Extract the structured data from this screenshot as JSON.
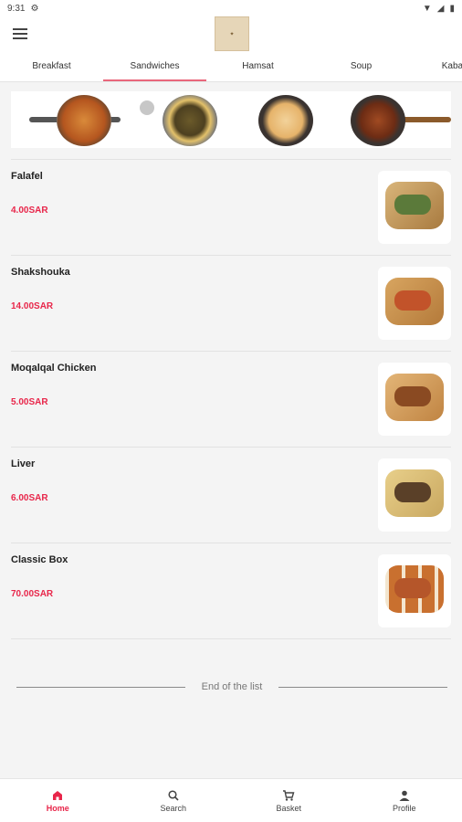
{
  "status": {
    "time": "9:31",
    "gear_icon": "gear-icon",
    "wifi_icon": "wifi-icon",
    "battery_icon": "battery-icon"
  },
  "header": {
    "menu_icon": "menu-icon",
    "logo_text": "logo"
  },
  "tabs": [
    {
      "label": "Breakfast"
    },
    {
      "label": "Sandwiches"
    },
    {
      "label": "Hamsat"
    },
    {
      "label": "Soup"
    },
    {
      "label": "Kabab & M"
    }
  ],
  "items": [
    {
      "name": "Falafel",
      "price": "4.00SAR"
    },
    {
      "name": "Shakshouka",
      "price": "14.00SAR"
    },
    {
      "name": "Moqalqal Chicken",
      "price": "5.00SAR"
    },
    {
      "name": "Liver",
      "price": "6.00SAR"
    },
    {
      "name": "Classic Box",
      "price": "70.00SAR"
    }
  ],
  "end_text": "End of the list",
  "nav": [
    {
      "label": "Home",
      "icon": "home-icon"
    },
    {
      "label": "Search",
      "icon": "search-icon"
    },
    {
      "label": "Basket",
      "icon": "cart-icon"
    },
    {
      "label": "Profile",
      "icon": "profile-icon"
    }
  ],
  "colors": {
    "accent": "#e8264a",
    "tab_indicator": "#e9677b"
  }
}
